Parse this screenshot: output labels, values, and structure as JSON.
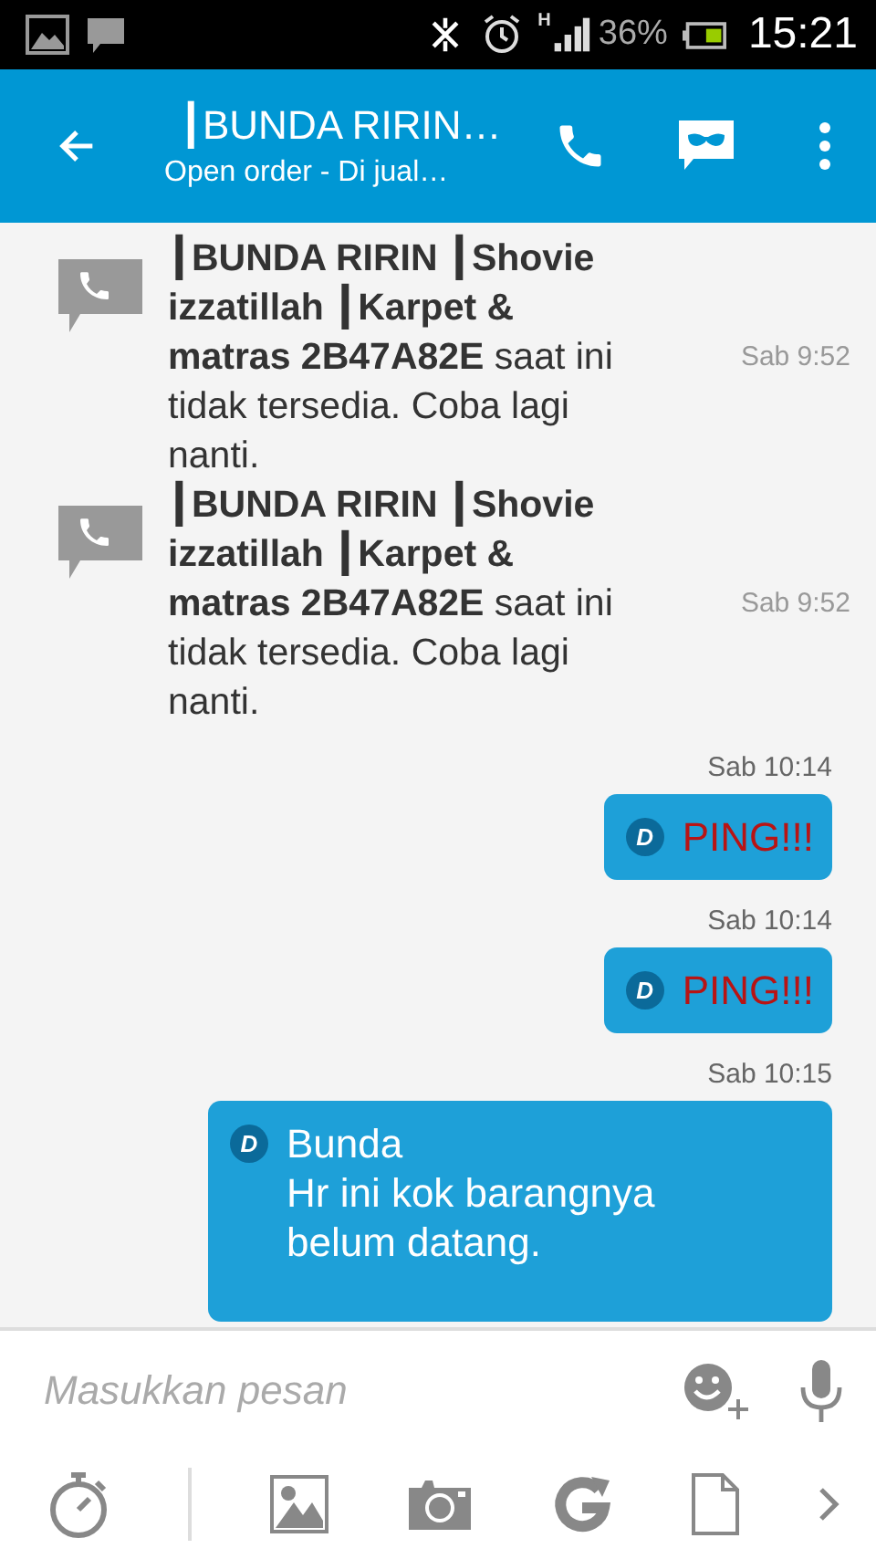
{
  "status_bar": {
    "battery_text": "36%",
    "time": "15:21",
    "network": "H"
  },
  "header": {
    "title": "┃BUNDA RIRIN…",
    "subtitle": "Open order - Di jual…"
  },
  "messages": [
    {
      "kind": "system",
      "text": "**┃BUNDA RIRIN ┃Shovie izzatillah ┃Karpet & matras 2B47A82E** saat ini tidak tersedia. Coba lagi nanti.",
      "time": "Sab 9:52"
    },
    {
      "kind": "system",
      "text": "**┃BUNDA RIRIN ┃Shovie izzatillah ┃Karpet & matras 2B47A82E** saat ini tidak tersedia. Coba lagi nanti.",
      "time": "Sab 9:52"
    },
    {
      "kind": "ping",
      "badge": "D",
      "text": "PING!!!",
      "time": "Sab 10:14"
    },
    {
      "kind": "ping",
      "badge": "D",
      "text": "PING!!!",
      "time": "Sab 10:14"
    },
    {
      "kind": "text",
      "badge": "D",
      "text": "Bunda\nHr ini kok barangnya\nbelum datang.",
      "time": "Sab 10:15"
    }
  ],
  "composer": {
    "placeholder": "Masukkan pesan"
  }
}
